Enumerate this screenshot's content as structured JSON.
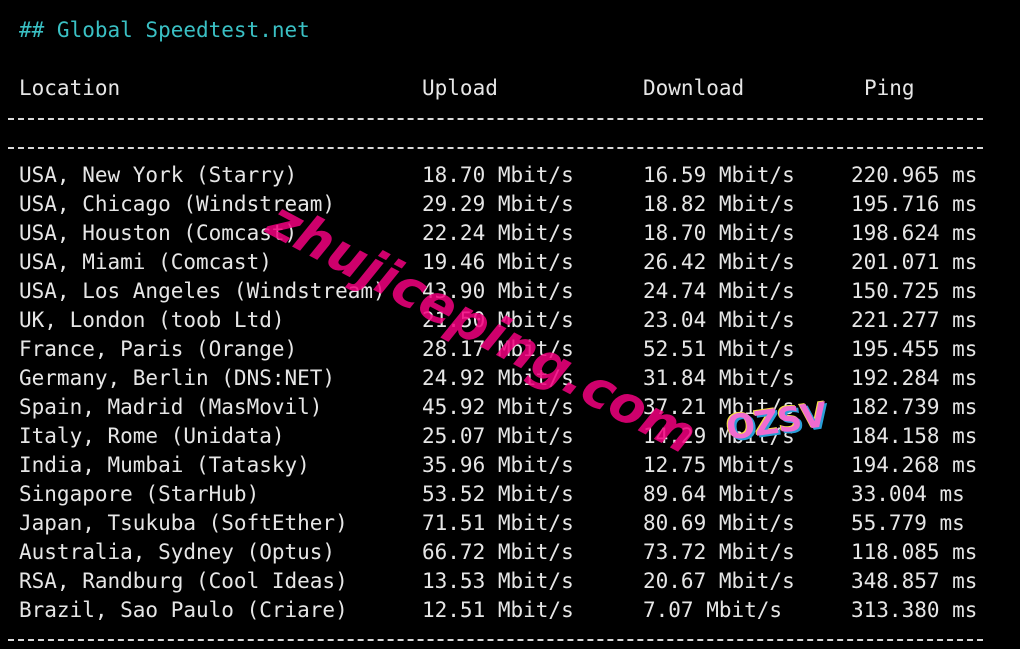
{
  "heading": "## Global Speedtest.net",
  "columns": {
    "location": "Location",
    "upload": "Upload",
    "download": "Download",
    "ping": "Ping"
  },
  "rows": [
    {
      "location": "USA, New York (Starry)",
      "upload": "18.70 Mbit/s",
      "download": "16.59 Mbit/s",
      "ping": "220.965 ms"
    },
    {
      "location": "USA, Chicago (Windstream)",
      "upload": "29.29 Mbit/s",
      "download": "18.82 Mbit/s",
      "ping": "195.716 ms"
    },
    {
      "location": "USA, Houston (Comcast)",
      "upload": "22.24 Mbit/s",
      "download": "18.70 Mbit/s",
      "ping": "198.624 ms"
    },
    {
      "location": "USA, Miami (Comcast)",
      "upload": "19.46 Mbit/s",
      "download": "26.42 Mbit/s",
      "ping": "201.071 ms"
    },
    {
      "location": "USA, Los Angeles (Windstream)",
      "upload": "43.90 Mbit/s",
      "download": "24.74 Mbit/s",
      "ping": "150.725 ms"
    },
    {
      "location": "UK, London (toob Ltd)",
      "upload": "21.50 Mbit/s",
      "download": "23.04 Mbit/s",
      "ping": "221.277 ms"
    },
    {
      "location": "France, Paris (Orange)",
      "upload": "28.17 Mbit/s",
      "download": "52.51 Mbit/s",
      "ping": "195.455 ms"
    },
    {
      "location": "Germany, Berlin (DNS:NET)",
      "upload": "24.92 Mbit/s",
      "download": "31.84 Mbit/s",
      "ping": "192.284 ms"
    },
    {
      "location": "Spain, Madrid (MasMovil)",
      "upload": "45.92 Mbit/s",
      "download": "37.21 Mbit/s",
      "ping": "182.739 ms"
    },
    {
      "location": "Italy, Rome (Unidata)",
      "upload": "25.07 Mbit/s",
      "download": "14.29 Mbit/s",
      "ping": "184.158 ms"
    },
    {
      "location": "India, Mumbai (Tatasky)",
      "upload": "35.96 Mbit/s",
      "download": "12.75 Mbit/s",
      "ping": "194.268 ms"
    },
    {
      "location": "Singapore (StarHub)",
      "upload": "53.52 Mbit/s",
      "download": "89.64 Mbit/s",
      "ping": "33.004 ms"
    },
    {
      "location": "Japan, Tsukuba (SoftEther)",
      "upload": "71.51 Mbit/s",
      "download": "80.69 Mbit/s",
      "ping": "55.779 ms"
    },
    {
      "location": "Australia, Sydney (Optus)",
      "upload": "66.72 Mbit/s",
      "download": "73.72 Mbit/s",
      "ping": "118.085 ms"
    },
    {
      "location": "RSA, Randburg (Cool Ideas)",
      "upload": "13.53 Mbit/s",
      "download": "20.67 Mbit/s",
      "ping": "348.857 ms"
    },
    {
      "location": "Brazil, Sao Paulo (Criare)",
      "upload": "12.51 Mbit/s",
      "download": "7.07 Mbit/s",
      "ping": "313.380 ms"
    }
  ],
  "watermark": "zhujiceping.com",
  "logo": "OZSV",
  "colors": {
    "background": "#000000",
    "text": "#e6e6e6",
    "heading": "#3ac0c4",
    "watermark": "#f3007f"
  }
}
